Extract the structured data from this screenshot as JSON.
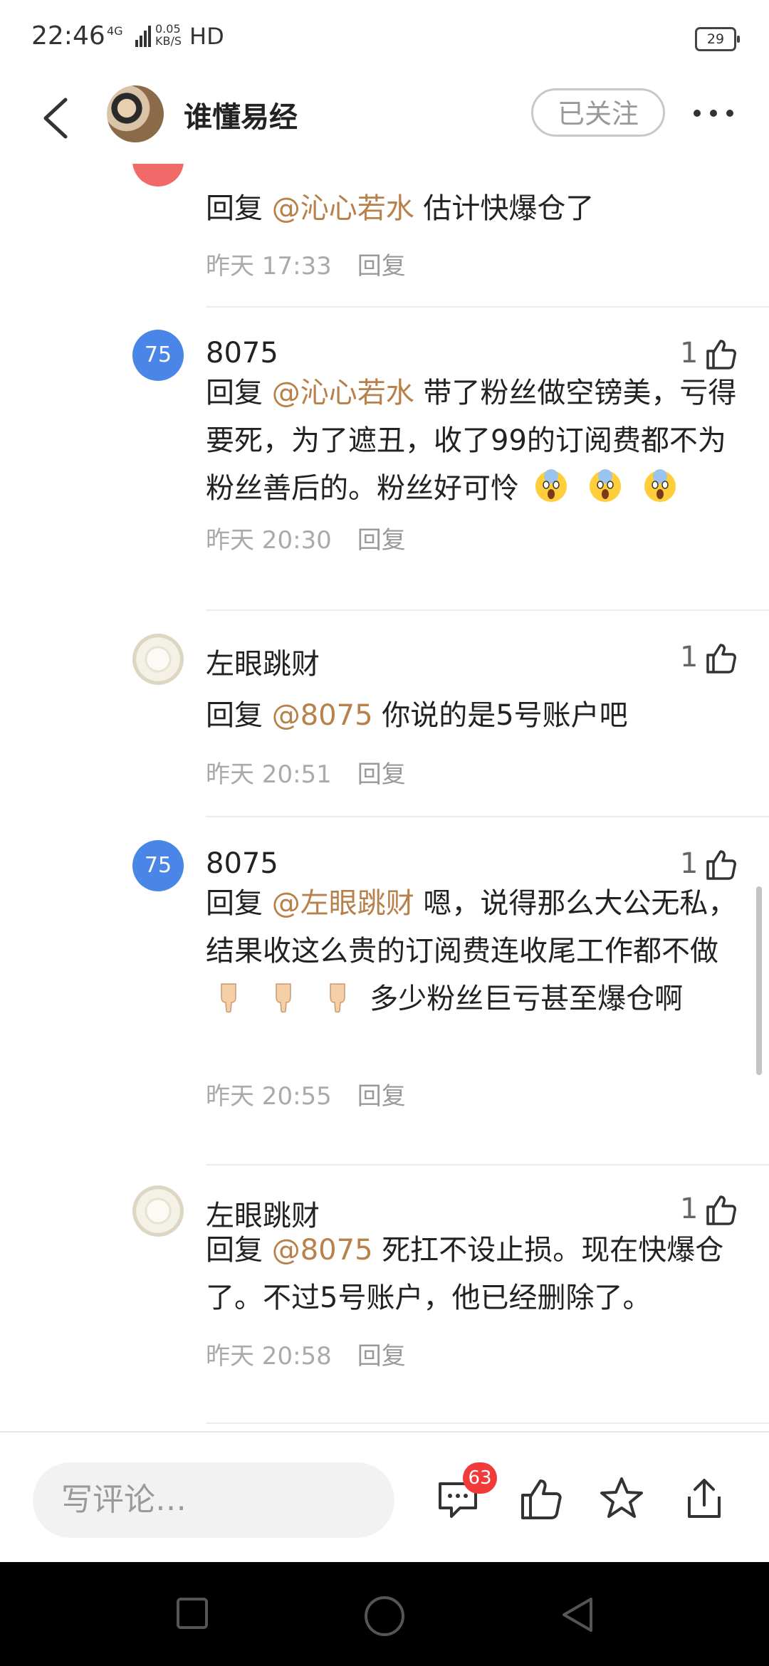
{
  "status_bar": {
    "time": "22:46",
    "network": "4G",
    "speed_value": "0.05",
    "speed_unit": "KB/S",
    "hd": "HD",
    "battery": "29"
  },
  "header": {
    "title": "谁懂易经",
    "follow_label": "已关注"
  },
  "comments": [
    {
      "text_prefix": "回复 ",
      "mention": "@沁心若水",
      "text": " 估计快爆仓了",
      "time": "昨天 17:33",
      "reply_label": "回复"
    },
    {
      "avatar_text": "75",
      "user": "8075",
      "likes": "1",
      "text_prefix": "回复 ",
      "mention": "@沁心若水",
      "text": " 带了粉丝做空镑美，亏得要死，为了遮丑，收了99的订阅费都不为粉丝善后的。粉丝好可怜",
      "emoji": "scream-emoji",
      "time": "昨天 20:30",
      "reply_label": "回复"
    },
    {
      "user": "左眼跳财",
      "likes": "1",
      "text_prefix": "回复 ",
      "mention": "@8075",
      "text": " 你说的是5号账户吧",
      "time": "昨天 20:51",
      "reply_label": "回复"
    },
    {
      "avatar_text": "75",
      "user": "8075",
      "likes": "1",
      "text_prefix": "回复 ",
      "mention": "@左眼跳财",
      "text": " 嗯，说得那么大公无私，结果收这么贵的订阅费连收尾工作都不做",
      "emoji": "point-down-emoji",
      "text_after": "多少粉丝巨亏甚至爆仓啊",
      "time": "昨天 20:55",
      "reply_label": "回复"
    },
    {
      "user": "左眼跳财",
      "likes": "1",
      "text_prefix": "回复 ",
      "mention": "@8075",
      "text": " 死扛不设止损。现在快爆仓了。不过5号账户，他已经删除了。",
      "time": "昨天 20:58",
      "reply_label": "回复"
    }
  ],
  "bottom_bar": {
    "input_placeholder": "写评论…",
    "comment_count": "63"
  },
  "icons": {
    "back": "back-arrow-icon",
    "more": "more-dots-icon",
    "like": "thumbs-up-icon",
    "comment": "comment-icon",
    "star": "star-icon",
    "share": "share-icon"
  },
  "colors": {
    "mention": "#b8804a",
    "badge": "#f23a3a",
    "avatar_blue": "#4a86e8",
    "meta_text": "#aaaaaa"
  }
}
